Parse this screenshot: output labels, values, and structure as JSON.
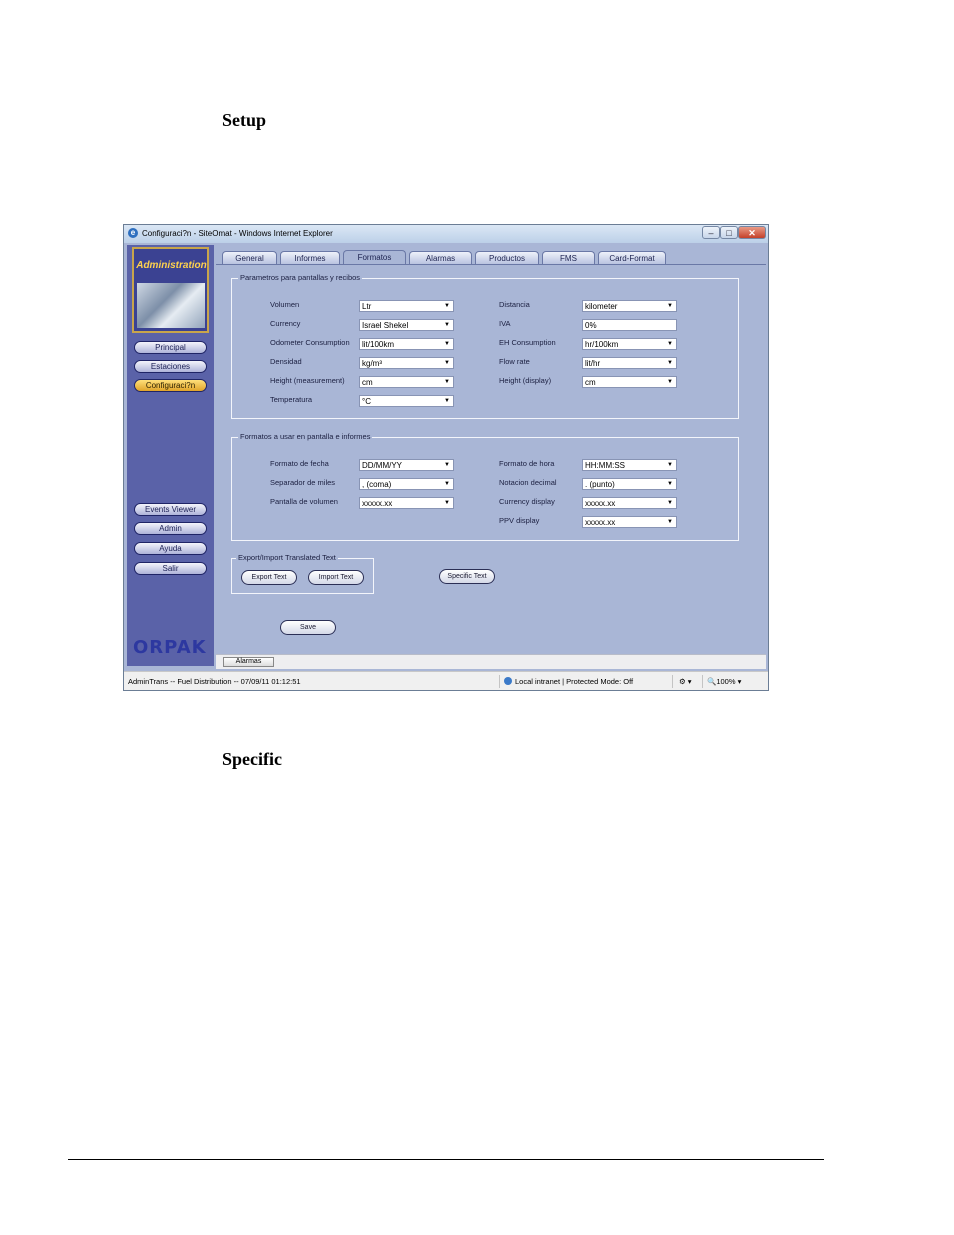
{
  "document": {
    "heading_setup": "Setup",
    "heading_specific": "Specific"
  },
  "window": {
    "title": "Configuraci?n - SiteOmat - Windows Internet Explorer",
    "buttons": {
      "minimize": "–",
      "maximize": "□",
      "close": "✕"
    }
  },
  "sidebar": {
    "logo_title": "Administration",
    "nav_top": [
      "Principal",
      "Estaciones",
      "Configuraci?n"
    ],
    "active_item": "Configuraci?n",
    "nav_bottom": [
      "Events Viewer",
      "Admin",
      "Ayuda",
      "Salir"
    ],
    "brand": "ORPAK"
  },
  "tabs": [
    "General",
    "Informes",
    "Formatos",
    "Alarmas",
    "Productos",
    "FMS",
    "Card-Format"
  ],
  "active_tab": "Formatos",
  "group1": {
    "title": "Parametros para pantallas y recibos",
    "left": [
      {
        "label": "Volumen",
        "value": "Ltr"
      },
      {
        "label": "Currency",
        "value": "Israel Shekel"
      },
      {
        "label": "Odometer Consumption",
        "value": "lit/100km"
      },
      {
        "label": "Densidad",
        "value": "kg/m³"
      },
      {
        "label": "Height (measurement)",
        "value": "cm"
      },
      {
        "label": "Temperatura",
        "value": "°C"
      }
    ],
    "right": [
      {
        "label": "Distancia",
        "value": "kilometer"
      },
      {
        "label": "IVA",
        "value": "0%"
      },
      {
        "label": "EH Consumption",
        "value": "hr/100km"
      },
      {
        "label": "Flow rate",
        "value": "lit/hr"
      },
      {
        "label": "Height (display)",
        "value": "cm"
      }
    ]
  },
  "group2": {
    "title": "Formatos a usar en pantalla e informes",
    "left": [
      {
        "label": "Formato de fecha",
        "value": "DD/MM/YY"
      },
      {
        "label": "Separador de miles",
        "value": ", (coma)"
      },
      {
        "label": "Pantalla de volumen",
        "value": "xxxxx.xx"
      }
    ],
    "right": [
      {
        "label": "Formato de hora",
        "value": "HH:MM:SS"
      },
      {
        "label": "Notacion decimal",
        "value": ". (punto)"
      },
      {
        "label": "Currency display",
        "value": "xxxxx.xx"
      },
      {
        "label": "PPV display",
        "value": "xxxxx.xx"
      }
    ]
  },
  "export_group": {
    "title": "Export/Import Translated Text",
    "export_label": "Export Text",
    "import_label": "Import Text"
  },
  "specific_text_label": "Specific Text",
  "save_label": "Save",
  "alarm_bar_label": "Alarmas",
  "statusbar": {
    "left": "AdminTrans -- Fuel Distribution -- 07/09/11  01:12:51",
    "zone": "Local intranet | Protected Mode: Off",
    "zoom": "100%"
  }
}
